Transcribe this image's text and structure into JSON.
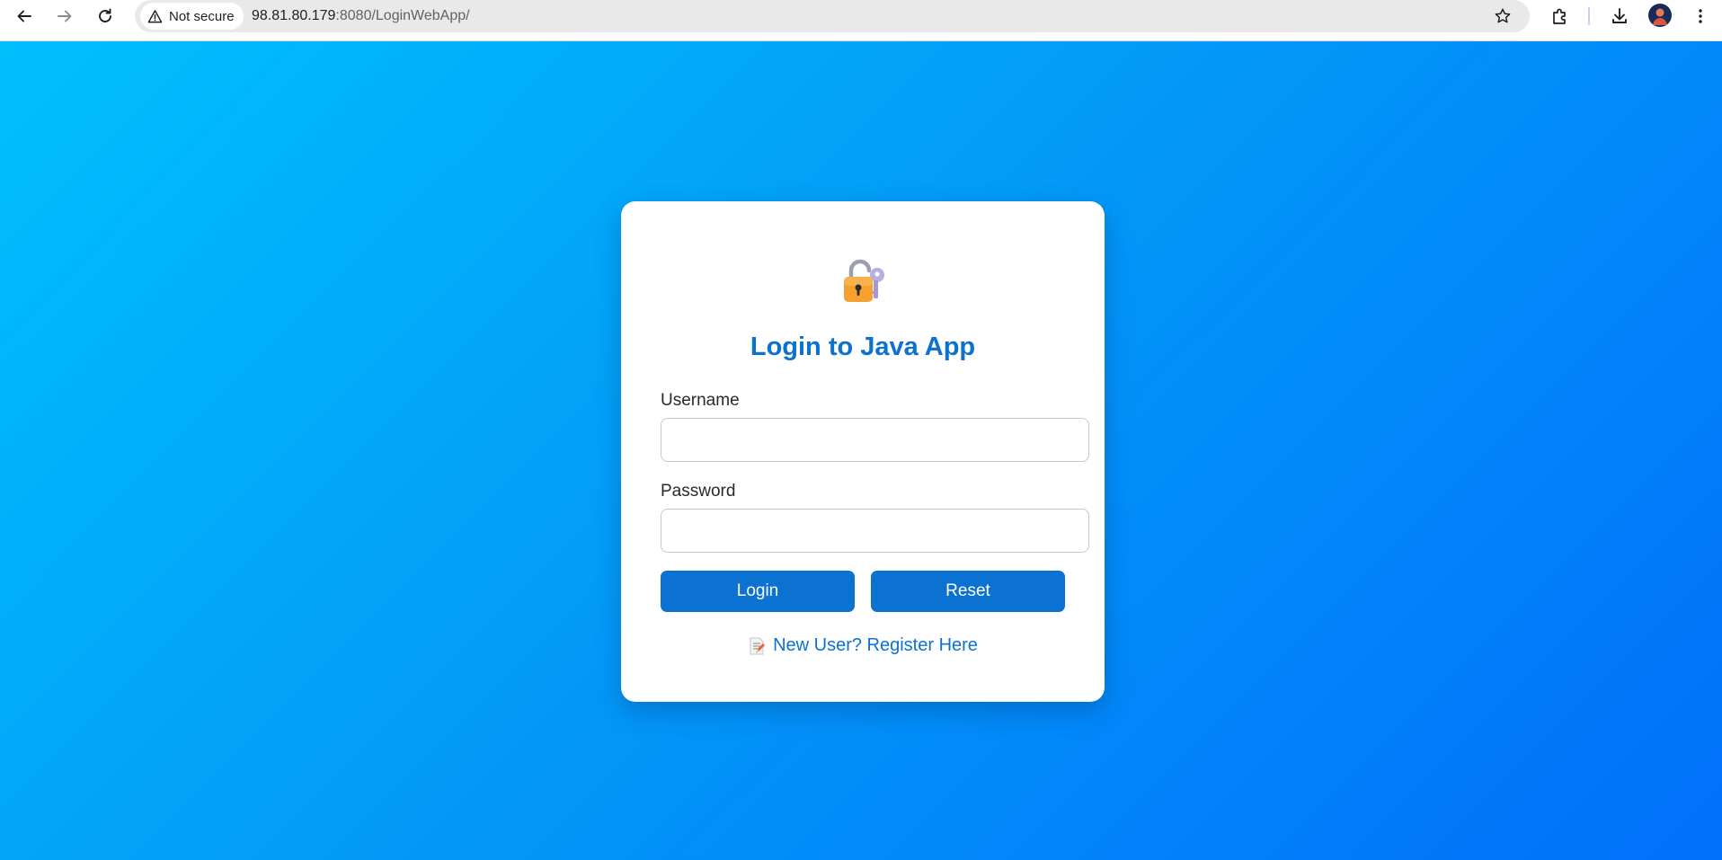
{
  "browser": {
    "security_label": "Not secure",
    "url_host": "98.81.80.179",
    "url_rest": ":8080/LoginWebApp/"
  },
  "login": {
    "title": "Login to Java App",
    "username_label": "Username",
    "username_value": "",
    "password_label": "Password",
    "password_value": "",
    "login_button": "Login",
    "reset_button": "Reset",
    "register_link": "New User? Register Here"
  },
  "icons": {
    "lock": "lock-with-key-icon",
    "register": "memo-icon"
  },
  "colors": {
    "accent": "#0b72d1",
    "background_start": "#00c0fc",
    "background_end": "#006ffb"
  }
}
